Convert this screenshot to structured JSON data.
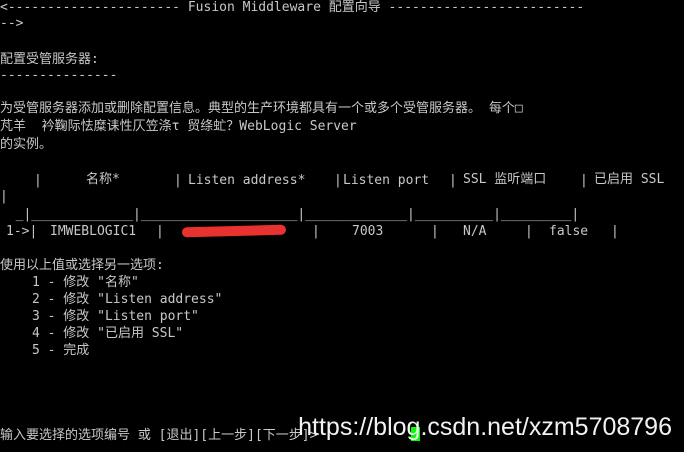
{
  "header": {
    "banner": "<---------------------- Fusion Middleware 配置向导 -------------------------",
    "banner_tail": "-->"
  },
  "section": {
    "title": "配置受管服务器:",
    "underline": "---------------"
  },
  "description": {
    "line1": "为受管服务器添加或删除配置信息。典型的生产环境都具有一个或多个受管服务器。 每个□",
    "line2": "芃羊  衿鞠际怯糜诔性仄笠涤τ 贸绦虻？WebLogic Server",
    "line3": "的实例。"
  },
  "table": {
    "columns": [
      "名称*",
      "Listen address*",
      "Listen port",
      "SSL 监听端口",
      "已启用 SSL"
    ],
    "header_wrap": "|",
    "separator": "  _|_____________|____________________|_____________|__________|_________|",
    "rows": [
      {
        "marker": "1->|",
        "name": "IMWEBLOGIC1",
        "listen_address": "",
        "listen_port": "7003",
        "ssl_port": "N/A",
        "ssl_enabled": "false"
      }
    ]
  },
  "menu": {
    "prompt": "使用以上值或选择另一选项:",
    "options": [
      "1 - 修改 \"名称\"",
      "2 - 修改 \"Listen address\"",
      "3 - 修改 \"Listen port\"",
      "4 - 修改 \"已启用 SSL\"",
      "5 - 完成"
    ]
  },
  "input": {
    "prompt": "输入要选择的选项编号 或 [退出][上一步][下一步]>"
  },
  "watermark": {
    "text": "https://blog.csdn.net/xzm5708796"
  },
  "colors": {
    "background": "#000000",
    "text": "#c8c8c8",
    "cursor": "#00ff00",
    "redaction": "#e8322f"
  }
}
